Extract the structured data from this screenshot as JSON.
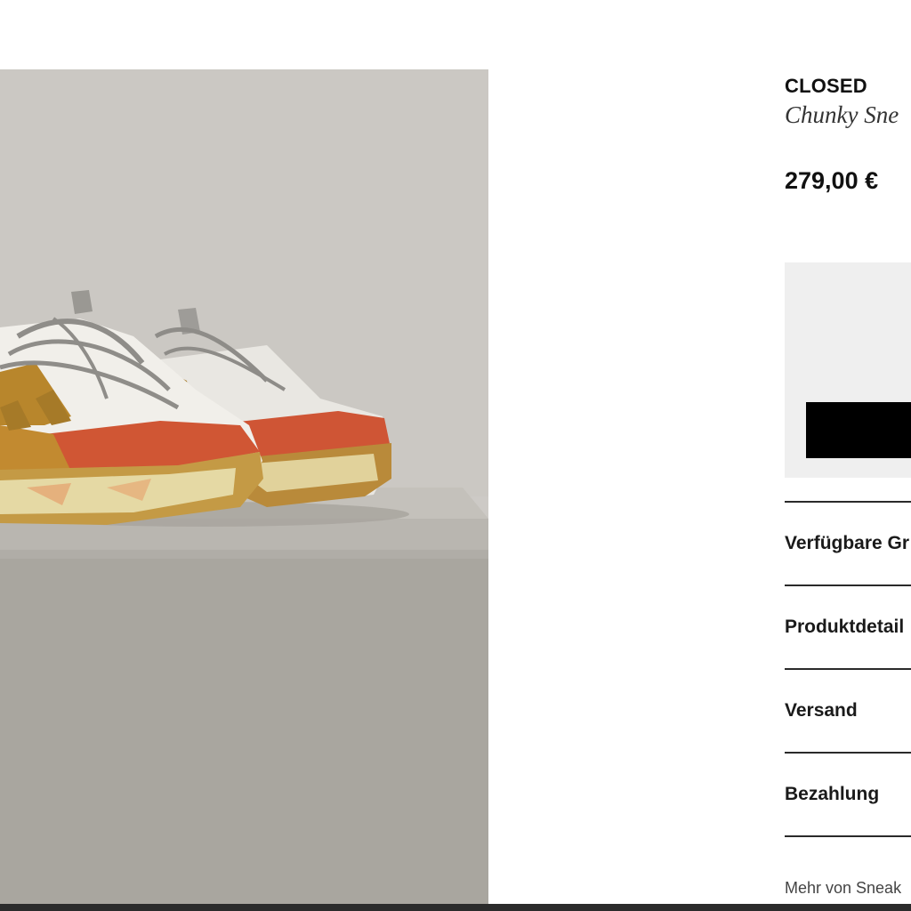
{
  "product": {
    "brand": "CLOSED",
    "name": "Chunky Sne",
    "price": "279,00 €"
  },
  "accordion": {
    "items": [
      {
        "label": "Verfügbare Gr"
      },
      {
        "label": "Produktdetail"
      },
      {
        "label": "Versand"
      },
      {
        "label": "Bezahlung"
      }
    ]
  },
  "more_link": "Mehr von Sneak",
  "colors": {
    "accent": "#000000",
    "panel": "#efefef",
    "divider": "#2a2a2a",
    "footer_bar": "#2b2b2b"
  },
  "icons": []
}
